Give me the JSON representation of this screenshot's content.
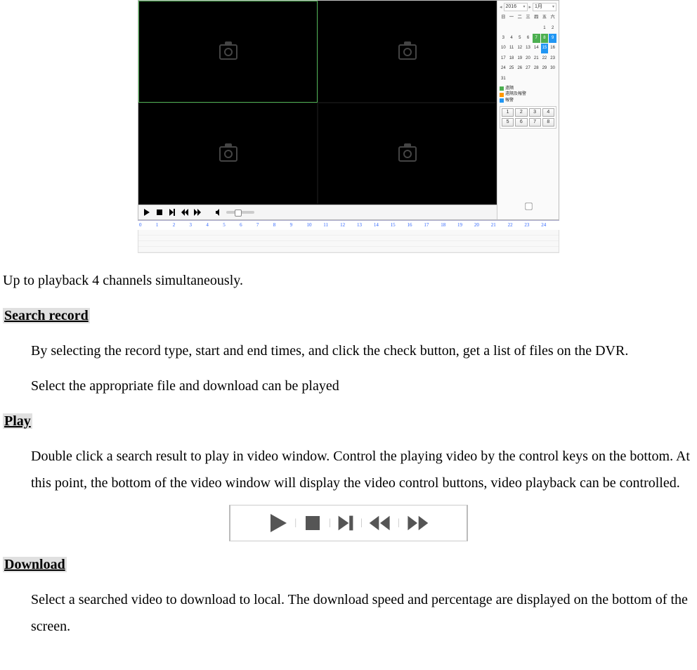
{
  "playback_panel": {
    "year": "2016",
    "month": "1月",
    "calendar_header": [
      "日",
      "一",
      "二",
      "三",
      "四",
      "五",
      "六"
    ],
    "calendar_days": [
      "",
      "",
      "",
      "",
      "",
      "1",
      "2",
      "3",
      "4",
      "5",
      "6",
      "7",
      "8",
      "9",
      "10",
      "11",
      "12",
      "13",
      "14",
      "15",
      "16",
      "17",
      "18",
      "19",
      "20",
      "21",
      "22",
      "23",
      "24",
      "25",
      "26",
      "27",
      "28",
      "29",
      "30",
      "31"
    ],
    "calendar_highlight_green": [
      "7",
      "8"
    ],
    "calendar_highlight_blue": [
      "9",
      "15"
    ],
    "legend": {
      "row1": "遠隔",
      "row2": "遠隔及報警",
      "row3": "報警"
    },
    "channels": [
      "1",
      "2",
      "3",
      "4",
      "5",
      "6",
      "7",
      "8"
    ],
    "timeline_hours": [
      "0",
      "1",
      "2",
      "3",
      "4",
      "5",
      "6",
      "7",
      "8",
      "9",
      "10",
      "11",
      "12",
      "13",
      "14",
      "15",
      "16",
      "17",
      "18",
      "19",
      "20",
      "21",
      "22",
      "23",
      "24"
    ]
  },
  "doc": {
    "intro": "Up to playback 4 channels simultaneously.",
    "search_title": "Search record",
    "search_p1": "By selecting the record type, start and end times, and click the check button, get a list of files on the DVR.",
    "search_p2": "Select the appropriate file and download can be played",
    "play_title": "Play",
    "play_p": "Double click a search result to play in video window. Control the playing video by the control keys on the bottom. At this point, the bottom of the video window will display the video control buttons, video playback can be controlled.",
    "download_title": "Download",
    "download_p": "Select a searched video to download to local. The download speed and percentage are displayed on the bottom of the screen."
  }
}
